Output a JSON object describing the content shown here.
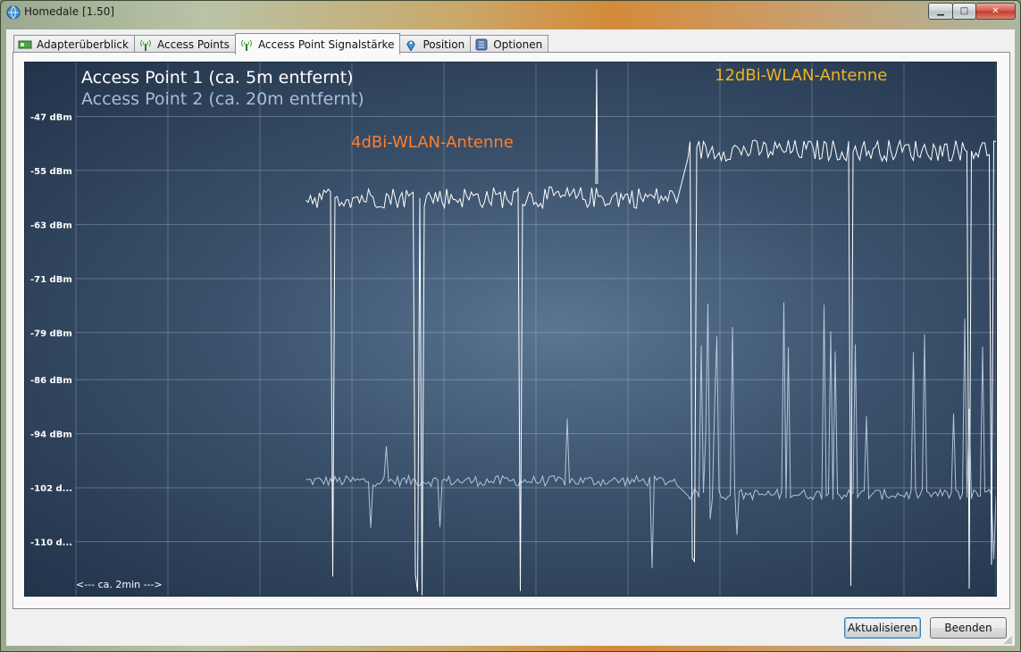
{
  "window": {
    "title": "Homedale [1.50]"
  },
  "tabs": [
    {
      "label": "Adapterüberblick",
      "icon": "network-adapter-icon"
    },
    {
      "label": "Access Points",
      "icon": "antenna-icon"
    },
    {
      "label": "Access Point Signalstärke",
      "icon": "antenna-signal-icon",
      "active": true
    },
    {
      "label": "Position",
      "icon": "map-pin-icon"
    },
    {
      "label": "Optionen",
      "icon": "settings-icon"
    }
  ],
  "chart": {
    "legend_ap1": "Access Point 1 (ca. 5m entfernt)",
    "legend_ap2": "Access Point 2 (ca. 20m entfernt)",
    "annotation_4dbi": "4dBi-WLAN-Antenne",
    "annotation_12dbi": "12dBi-WLAN-Antenne",
    "time_label": "<--- ca. 2min --->"
  },
  "chart_data": {
    "type": "line",
    "yticks": [
      "-47 dBm",
      "-55 dBm",
      "-63 dBm",
      "-71 dBm",
      "-79 dBm",
      "-86 dBm",
      "-94 dBm",
      "-102 d...",
      "-110 d..."
    ],
    "ytick_values": [
      -47,
      -55,
      -63,
      -71,
      -79,
      -86,
      -94,
      -102,
      -110
    ],
    "ylim": [
      -118,
      -39
    ],
    "grid": true,
    "series": [
      {
        "name": "Access Point 1 (ca. 5m entfernt)",
        "color": "#ffffff",
        "segments": [
          {
            "x_range": [
              0.25,
              0.655
            ],
            "level": -59
          },
          {
            "x_range": [
              0.665,
              1.0
            ],
            "level": -52
          }
        ]
      },
      {
        "name": "Access Point 2 (ca. 20m entfernt)",
        "color": "#c8d8ea",
        "segments": [
          {
            "x_range": [
              0.25,
              0.655
            ],
            "level": -101
          },
          {
            "x_range": [
              0.665,
              1.0
            ],
            "level": -103
          }
        ]
      }
    ]
  },
  "buttons": {
    "refresh": "Aktualisieren",
    "exit": "Beenden"
  },
  "colors": {
    "ap1": "#ffffff",
    "ap2": "#a9bdd6",
    "annotation_4dbi": "#ff7f2a",
    "annotation_12dbi": "#f2b31c"
  }
}
